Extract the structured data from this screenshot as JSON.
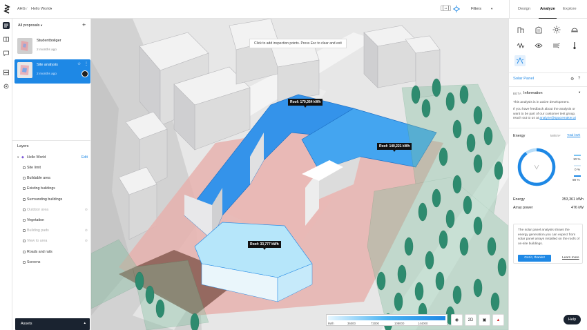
{
  "app": {
    "breadcrumb_org": "AHG",
    "breadcrumb_project": "Hello World",
    "filters_label": "Filters",
    "tabs": [
      {
        "label": "Design"
      },
      {
        "label": "Analyze"
      },
      {
        "label": "Explore"
      }
    ],
    "active_tab": "Analyze"
  },
  "proposals": {
    "header": "All proposals",
    "items": [
      {
        "name": "Studentboliger",
        "time": "2 months ago"
      },
      {
        "name": "Site analysis",
        "time": "2 months ago"
      }
    ]
  },
  "layers": {
    "title": "Layers",
    "root": "Hello World",
    "edit_label": "Edit",
    "items": [
      {
        "label": "Site limit",
        "dim": false
      },
      {
        "label": "Buildable area",
        "dim": false
      },
      {
        "label": "Existing buildings",
        "dim": false
      },
      {
        "label": "Surrounding buildings",
        "dim": false
      },
      {
        "label": "Outdoor area",
        "dim": true
      },
      {
        "label": "Vegetation",
        "dim": false
      },
      {
        "label": "Building pads",
        "dim": true
      },
      {
        "label": "View to area",
        "dim": true
      },
      {
        "label": "Roads and rails",
        "dim": false
      },
      {
        "label": "Screens",
        "dim": false
      }
    ]
  },
  "assets_label": "Assets",
  "map": {
    "tooltip": "Click to add inspection points. Press Esc to clear and exit",
    "roof_labels": [
      "Roof: 179,364 kWh",
      "Roof: 140,221 kWh",
      "Roof: 33,777 kWh"
    ],
    "legend_unit": "kWh",
    "legend_values": [
      "36000",
      "72000",
      "108000",
      "144000"
    ],
    "btn_2d": "2D"
  },
  "solar": {
    "title": "Solar Panel",
    "beta": "BETA",
    "info_title": "Information",
    "info_p1": "This analysis is in active development.",
    "info_p2": "If you have feedback about the analysis or want to be part of our customer test group, reach out to us at",
    "info_email": "analyze@spacemaker.ai",
    "energy_label": "Energy",
    "energy_unit_option": "kWh/m²",
    "energy_total_option": "Total kWh",
    "pct_items": [
      "10 %",
      "0 %",
      "90 %"
    ],
    "energy_value_label": "Energy",
    "energy_value": "353,361 kWh",
    "array_label": "Array power",
    "array_value": "476 kW",
    "card_text": "The solar panel analysis shows the energy generation you can expect from solar panel arrays installed on the roofs of on-site buildings.",
    "got_it": "Got it, thanks!",
    "learn_more": "Learn more"
  },
  "help_label": "Help",
  "colors": {
    "accent": "#1e88e5",
    "dark": "#1a2330",
    "roof_high": "#2f8fe8",
    "roof_mid": "#4aa8f0",
    "roof_low": "#b9e7fb",
    "site_pink": "#e7b3b1",
    "tree": "#2e8b6f"
  }
}
